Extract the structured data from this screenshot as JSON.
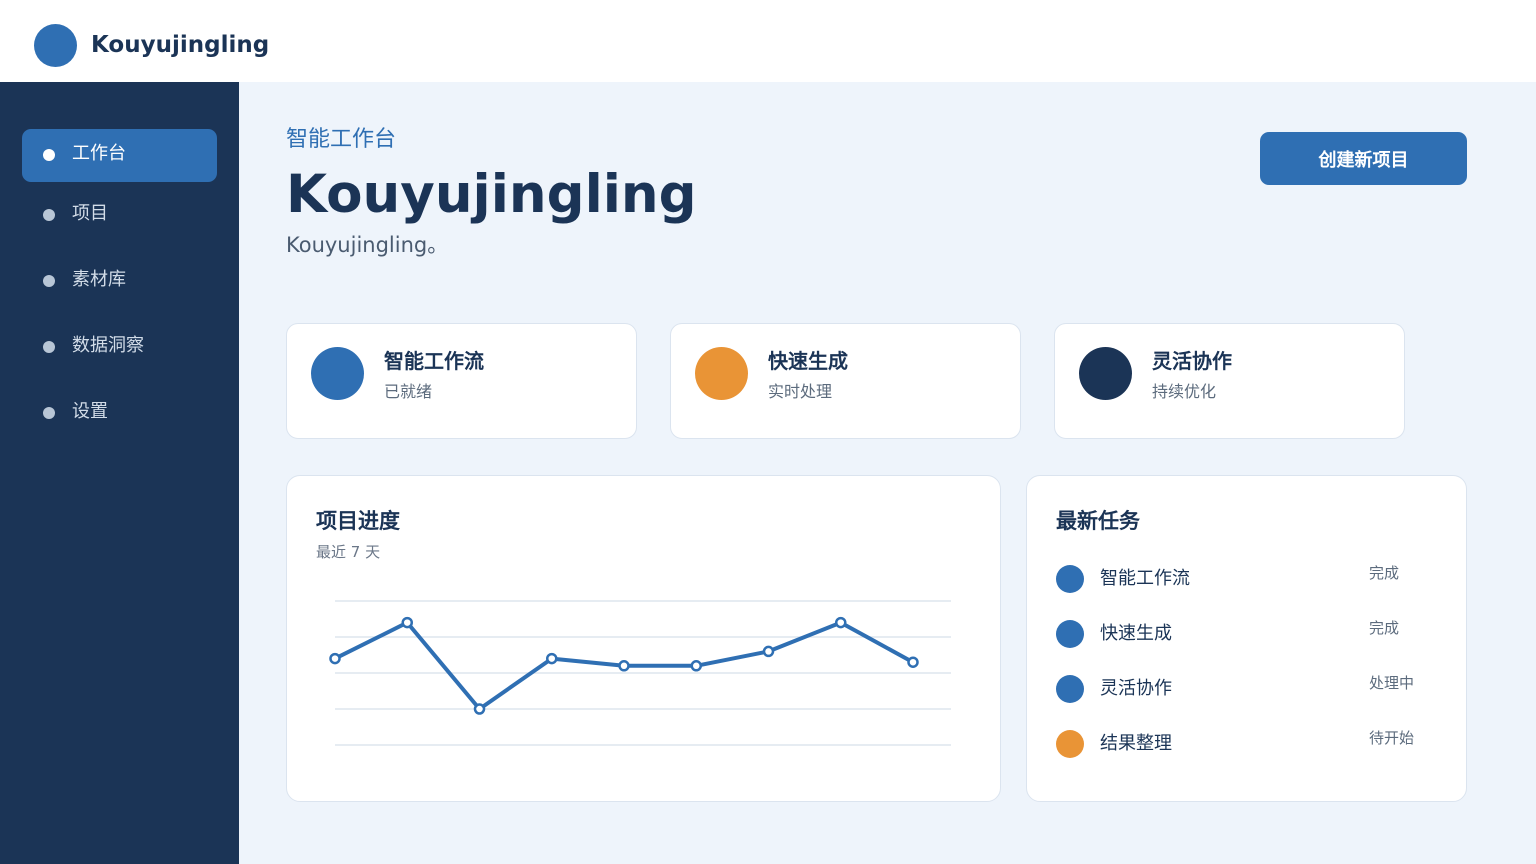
{
  "app": {
    "brand": "Kouyujingling"
  },
  "sidebar": {
    "items": [
      {
        "label": "工作台",
        "active": true
      },
      {
        "label": "项目",
        "active": false
      },
      {
        "label": "素材库",
        "active": false
      },
      {
        "label": "数据洞察",
        "active": false
      },
      {
        "label": "设置",
        "active": false
      }
    ]
  },
  "header": {
    "eyebrow": "智能工作台",
    "title": "Kouyujingling",
    "subtitle": "Kouyujingling。",
    "create_button": "创建新项目"
  },
  "stats": [
    {
      "title": "智能工作流",
      "sub": "已就绪",
      "color": "#2f6fb3"
    },
    {
      "title": "快速生成",
      "sub": "实时处理",
      "color": "#e99436"
    },
    {
      "title": "灵活协作",
      "sub": "持续优化",
      "color": "#1b3456"
    }
  ],
  "progress_panel": {
    "title": "项目进度",
    "subtitle": "最近 7 天"
  },
  "chart_data": {
    "type": "line",
    "title": "项目进度",
    "subtitle": "最近 7 天",
    "values": [
      74,
      84,
      60,
      74,
      72,
      72,
      76,
      84,
      73
    ],
    "ylim": [
      50,
      90
    ],
    "grid": true,
    "color": "#2f6fb3"
  },
  "tasks_panel": {
    "title": "最新任务",
    "tasks": [
      {
        "name": "智能工作流",
        "status": "完成",
        "color": "#2f6fb3"
      },
      {
        "name": "快速生成",
        "status": "完成",
        "color": "#2f6fb3"
      },
      {
        "name": "灵活协作",
        "status": "处理中",
        "color": "#2f6fb3"
      },
      {
        "name": "结果整理",
        "status": "待开始",
        "color": "#e99436"
      }
    ]
  }
}
